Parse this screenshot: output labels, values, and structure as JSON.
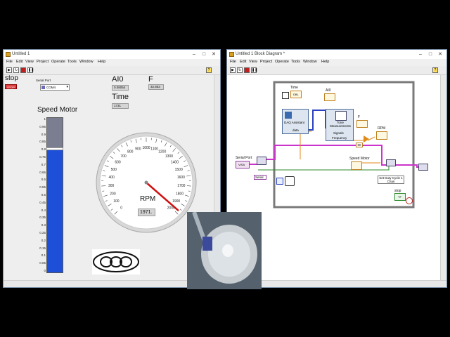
{
  "front_panel": {
    "title": "Untitled 1",
    "menu": [
      "File",
      "Edit",
      "View",
      "Project",
      "Operate",
      "Tools",
      "Window",
      "Help"
    ],
    "stop_label": "stop",
    "stop_button": "STOP",
    "serial_port_label": "Serial Port",
    "serial_port_value": "COM4",
    "ai0_label": "AI0",
    "ai0_value": "0.08054",
    "f_label": "F",
    "f_value": "32.853",
    "time_label": "Time",
    "time_value": "1731",
    "speed_motor_label": "Speed Motor",
    "speed_ticks": [
      "1",
      "0.95",
      "0.9",
      "0.85",
      "0.8",
      "0.75",
      "0.7",
      "0.65",
      "0.6",
      "0.55",
      "0.5",
      "0.45",
      "0.4",
      "0.35",
      "0.3",
      "0.25",
      "0.2",
      "0.15",
      "0.1",
      "0.05",
      "0"
    ],
    "speed_level": 0.8,
    "rpm_label": "RPM",
    "rpm_value": "1971.",
    "rpm_ticks": [
      "0",
      "100",
      "200",
      "300",
      "400",
      "500",
      "600",
      "700",
      "800",
      "900",
      "1000",
      "1100",
      "1200",
      "1300",
      "1400",
      "1500",
      "1600",
      "1700",
      "1800",
      "1900",
      "2000"
    ],
    "rpm_needle_value": 1971
  },
  "block_diagram": {
    "title": "Untitled 1 Block Diagram *",
    "menu": [
      "File",
      "Edit",
      "View",
      "Project",
      "Operate",
      "Tools",
      "Window",
      "Help"
    ],
    "time_node": "Time",
    "ai0_node": "AI0",
    "daq_label": "DAQ Assistant",
    "daq_data": "data",
    "tone_label": "Tone Measurements",
    "tone_signals": "Signals",
    "tone_frequency": "Frequency",
    "f_node": "F",
    "rpm_node": "RPM",
    "const_60": "60",
    "serial_port_node": "Serial Port",
    "serial_port_terminal": "VISA",
    "serial_ring": "Serial",
    "speed_motor_node": "Speed Motor",
    "duty_cycle_label": "Set Duty Cycle 1 Chan",
    "stop_node": "stop",
    "tf_terminal": "TF",
    "dbl_terminal": "DBL"
  },
  "colors": {
    "bar_fill": "#1e4fd8",
    "needle": "#d01010",
    "wire_pink": "#cc33cc",
    "wire_orange": "#e08a18",
    "wire_green": "#2a8a2a",
    "while_loop": "#7a7a7a"
  }
}
